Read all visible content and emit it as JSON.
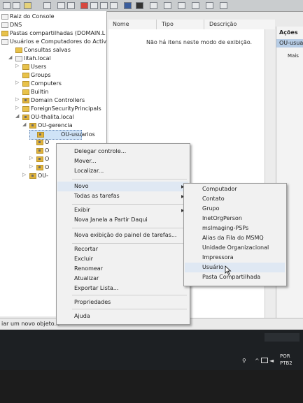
{
  "tree": {
    "root": "Raiz do Console",
    "items": [
      {
        "label": "DNS"
      },
      {
        "label": "Pastas compartilhadas (DOMAIN.L"
      },
      {
        "label": "Usuários e Computadores do Activ"
      },
      {
        "label": "Consultas salvas"
      },
      {
        "label": "litah.local"
      },
      {
        "label": "Users"
      },
      {
        "label": "Groups"
      },
      {
        "label": "Computers"
      },
      {
        "label": "Builtin"
      },
      {
        "label": "Domain Controllers"
      },
      {
        "label": "ForeignSecurityPrincipals"
      },
      {
        "label": "OU-thalita.local"
      },
      {
        "label": "OU-gerencia"
      },
      {
        "label": "OU-usuarios"
      },
      {
        "label": "O"
      },
      {
        "label": "O"
      },
      {
        "label": "O"
      },
      {
        "label": "O"
      },
      {
        "label": "OU-"
      }
    ]
  },
  "list": {
    "columns": [
      "Nome",
      "Tipo",
      "Descrição"
    ],
    "empty_message": "Não há itens neste modo de exibição."
  },
  "actions": {
    "header": "Ações",
    "item1": "OU-usuari",
    "item2": "Mais"
  },
  "context_menu": {
    "items": [
      "Delegar controle...",
      "Mover...",
      "Localizar...",
      "Novo",
      "Todas as tarefas",
      "Exibir",
      "Nova Janela a Partir Daqui",
      "Nova exibição do painel de tarefas...",
      "Recortar",
      "Excluir",
      "Renomear",
      "Atualizar",
      "Exportar Lista...",
      "Propriedades",
      "Ajuda"
    ]
  },
  "submenu": {
    "items": [
      "Computador",
      "Contato",
      "Grupo",
      "InetOrgPerson",
      "msImaging-PSPs",
      "Alias da Fila do MSMQ",
      "Unidade Organizacional",
      "Impressora",
      "Usuário",
      "Pasta Compartilhada"
    ]
  },
  "status": {
    "text": "iar um novo objeto..."
  },
  "taskbar": {
    "lang1": "POR",
    "lang2": "PTB2"
  },
  "colors": {
    "folder": "#e8c24a",
    "selection": "#cfe3f7",
    "taskbar": "#1d2023"
  }
}
